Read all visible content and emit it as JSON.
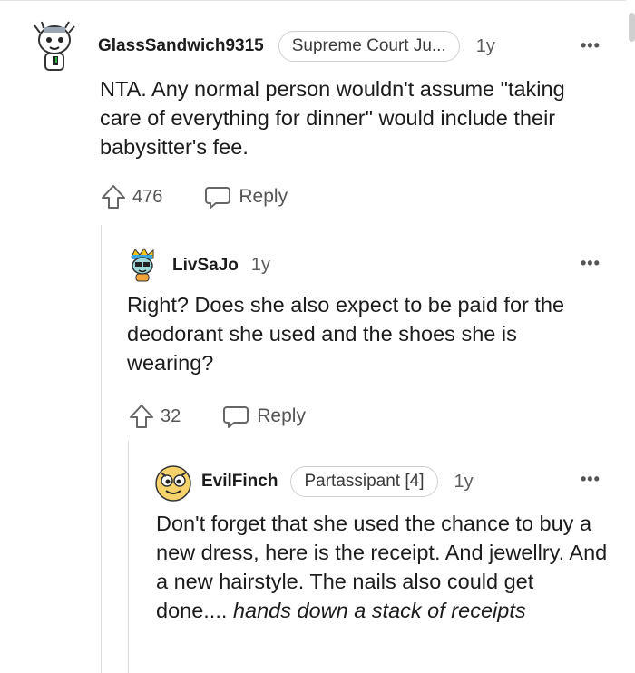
{
  "comments": [
    {
      "username": "GlassSandwich9315",
      "flair": "Supreme Court Ju...",
      "age": "1y",
      "more": "•••",
      "body": "NTA. Any normal person wouldn't assume \"taking care of everything for dinner\" would include their babysitter's fee.",
      "upvotes": "476",
      "reply_label": "Reply"
    },
    {
      "username": "LivSaJo",
      "age": "1y",
      "more": "•••",
      "body": "Right? Does she also expect to be paid for the deodorant she used and the shoes she is wearing?",
      "upvotes": "32",
      "reply_label": "Reply"
    },
    {
      "username": "EvilFinch",
      "flair": "Partassipant [4]",
      "age": "1y",
      "more": "•••",
      "body": "Don't forget that she used the chance to buy a new dress, here is the receipt. And jewellry. And a new hairstyle. The nails also could get done....",
      "body_italic": "hands down a stack of receipts"
    }
  ],
  "colors": {
    "text": "#1c1c1c",
    "muted": "#5c5c5c",
    "border": "#cfcfcf",
    "thread_line": "#dcdcdc"
  },
  "icons": [
    "upvote-icon",
    "reply-icon",
    "more-options-icon",
    "avatar"
  ]
}
